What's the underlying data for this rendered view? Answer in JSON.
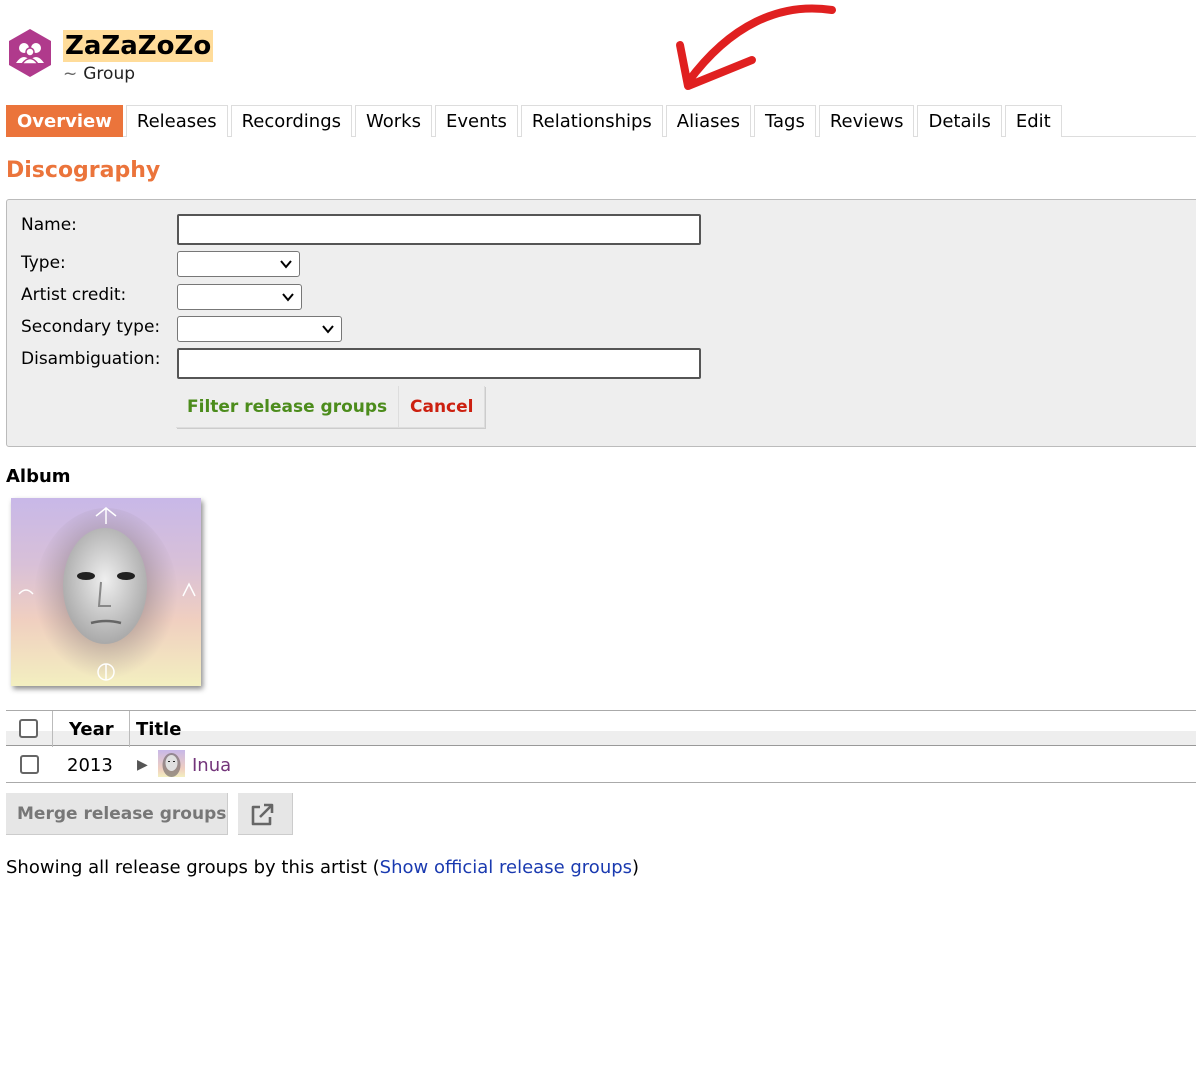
{
  "artist": {
    "name": "ZaZaZoZo",
    "type_prefix": "~",
    "type": "Group",
    "icon": "group-icon"
  },
  "tabs": [
    {
      "label": "Overview",
      "active": true
    },
    {
      "label": "Releases"
    },
    {
      "label": "Recordings"
    },
    {
      "label": "Works"
    },
    {
      "label": "Events"
    },
    {
      "label": "Relationships"
    },
    {
      "label": "Aliases"
    },
    {
      "label": "Tags"
    },
    {
      "label": "Reviews"
    },
    {
      "label": "Details"
    },
    {
      "label": "Edit"
    }
  ],
  "discography": {
    "heading": "Discography",
    "filter": {
      "name_label": "Name:",
      "name_value": "",
      "type_label": "Type:",
      "type_value": "",
      "artist_credit_label": "Artist credit:",
      "artist_credit_value": "",
      "secondary_type_label": "Secondary type:",
      "secondary_type_value": "",
      "disambiguation_label": "Disambiguation:",
      "disambiguation_value": "",
      "filter_button": "Filter release groups",
      "cancel_button": "Cancel"
    },
    "section_title": "Album",
    "table": {
      "columns": [
        "Year",
        "Title"
      ],
      "rows": [
        {
          "year": "2013",
          "title": "Inua"
        }
      ]
    },
    "merge_button": "Merge release groups",
    "external_icon": "external-link-icon",
    "footer_text": "Showing all release groups by this artist (",
    "footer_link": "Show official release groups",
    "footer_close": ")"
  },
  "colors": {
    "accent": "#eb743b",
    "highlight": "#ffdc9a",
    "filter_green": "#4c8c1c",
    "cancel_red": "#cc2010",
    "link_purple": "#73357a",
    "link_blue": "#1a3ab0",
    "annotation_red": "#e02020"
  }
}
